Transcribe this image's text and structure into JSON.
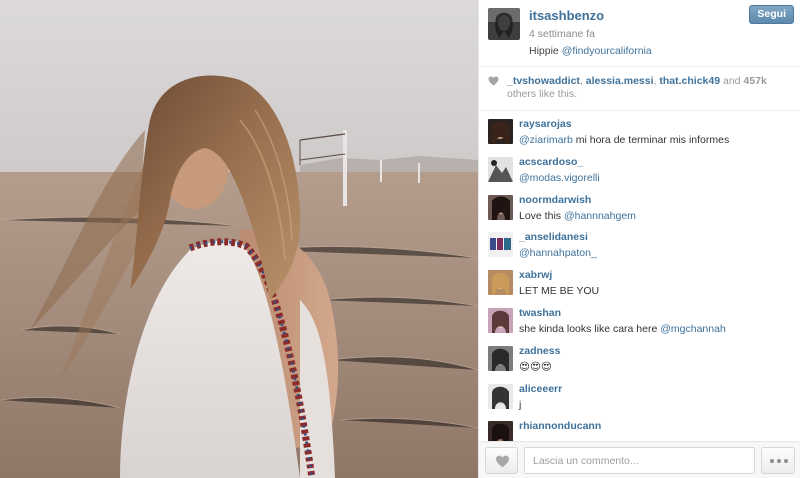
{
  "post": {
    "username": "itsashbenzo",
    "time": "4 settimane fa",
    "caption_text": "Hippie ",
    "caption_mention": "@findyourcalifornia",
    "follow_label": "Segui"
  },
  "likes": {
    "likers": [
      "_tvshowaddict",
      "alessia.messi",
      "that.chick49"
    ],
    "and_word": " and ",
    "count": "457k",
    "suffix": "others like this."
  },
  "comments": [
    {
      "user": "raysarojas",
      "mention": "@ziarimarb",
      "text": " mi hora de terminar mis informes"
    },
    {
      "user": "acscardoso_",
      "mention": "@modas.vigorelli",
      "text": ""
    },
    {
      "user": "noormdarwish",
      "mention": "",
      "text": "Love this ",
      "mention_after": "@hannnahgem"
    },
    {
      "user": "_anselidanesi",
      "mention": "@hannahpaton_",
      "text": ""
    },
    {
      "user": "xabrwj",
      "mention": "",
      "text": "LET ME BE YOU"
    },
    {
      "user": "twashan",
      "mention": "",
      "text": "she kinda looks like cara here ",
      "mention_after": "@mgchannah"
    },
    {
      "user": "zadness",
      "mention": "",
      "text": "😍😍😍"
    },
    {
      "user": "aliceeerr",
      "mention": "",
      "text": "j"
    },
    {
      "user": "rhiannonducann",
      "mention": "",
      "text": ""
    }
  ],
  "footer": {
    "comment_placeholder": "Lascia un commento...",
    "like_icon": "heart-icon",
    "more_icon": "more-dots-icon"
  },
  "colors": {
    "link": "#3f729b",
    "follow_button": "#6f97b6",
    "panel_border": "#e6e6e6"
  }
}
